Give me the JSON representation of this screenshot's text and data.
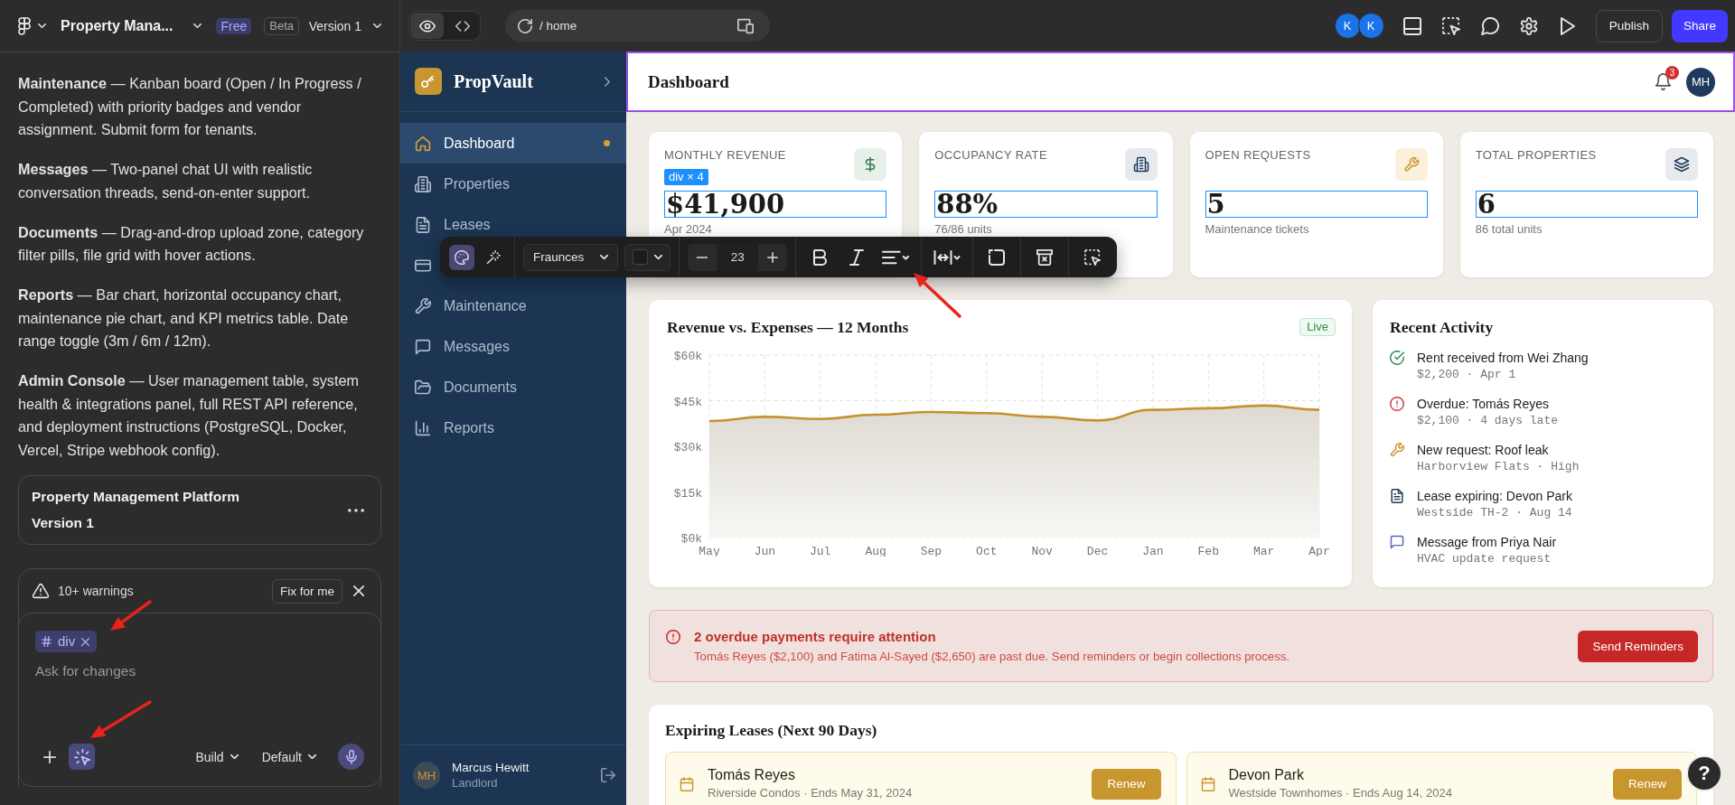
{
  "editor": {
    "project": "Property Mana...",
    "plan": "Free",
    "stage": "Beta",
    "version": "Version 1",
    "notes": [
      "**Maintenance** — Kanban board (Open / In Progress / Completed) with priority badges and vendor assignment. Submit form for tenants.",
      "**Messages** — Two-panel chat UI with realistic conversation threads, send-on-enter support.",
      "**Documents** — Drag-and-drop upload zone, category filter pills, file grid with hover actions.",
      "**Reports** — Bar chart, horizontal occupancy chart, maintenance pie chart, and KPI metrics table. Date range toggle (3m / 6m / 12m).",
      "**Admin Console** — User management table, system health & integrations panel, full REST API reference, and deployment instructions (PostgreSQL, Docker, Vercel, Stripe webhook config)."
    ],
    "project_card": {
      "title": "Property Management Platform",
      "subtitle": "Version 1"
    },
    "warnings": {
      "label": "10+ warnings",
      "action": "Fix for me"
    },
    "composer": {
      "chip": "div",
      "placeholder": "Ask for changes",
      "select_tool_on": true,
      "mode": "Build",
      "model": "Default"
    }
  },
  "topbar": {
    "views": [
      {
        "kind": "eye",
        "selected": true
      },
      {
        "kind": "code",
        "selected": false
      }
    ],
    "path": "/ home",
    "collaborators": [
      "K",
      "K"
    ],
    "publish": "Publish",
    "share": "Share"
  },
  "app": {
    "brand": "PropVault",
    "nav": [
      {
        "label": "Dashboard",
        "kind": "home",
        "selected": true,
        "dot": true
      },
      {
        "label": "Properties",
        "kind": "building",
        "selected": false,
        "dot": false
      },
      {
        "label": "Leases",
        "kind": "document",
        "selected": false,
        "dot": false
      },
      {
        "kind": "card",
        "selected": false,
        "dot": false
      },
      {
        "label": "Maintenance",
        "kind": "wrench",
        "selected": false,
        "dot": false
      },
      {
        "label": "Messages",
        "kind": "chat",
        "selected": false,
        "dot": false
      },
      {
        "label": "Documents",
        "kind": "folder",
        "selected": false,
        "dot": false
      },
      {
        "label": "Reports",
        "kind": "chart",
        "selected": false,
        "dot": false
      }
    ],
    "user": {
      "initials": "MH",
      "name": "Marcus Hewitt",
      "role": "Landlord"
    },
    "header": {
      "title": "Dashboard",
      "notifications": "3",
      "initials": "MH"
    },
    "kpis": [
      {
        "label": "MONTHLY REVENUE",
        "value": "$41,900",
        "sub": "Apr 2024",
        "kind": "dollar",
        "selected": true,
        "tag": "div × 4"
      },
      {
        "label": "OCCUPANCY RATE",
        "value": "88%",
        "sub": "76/86 units",
        "kind": "building",
        "selected": true
      },
      {
        "label": "OPEN REQUESTS",
        "value": "5",
        "sub": "Maintenance tickets",
        "kind": "wrench",
        "selected": true
      },
      {
        "label": "TOTAL PROPERTIES",
        "value": "6",
        "sub": "86 total units",
        "kind": "layers",
        "selected": true
      }
    ],
    "format_toolbar": {
      "modes": [
        {
          "kind": "palette",
          "selected": true
        },
        {
          "kind": "wand",
          "selected": false
        }
      ],
      "font": "Fraunces",
      "color": "#1c1c1c",
      "size": "23"
    },
    "revenue": {
      "title": "Revenue vs. Expenses — 12 Months",
      "status": "Live",
      "chart_data": {
        "type": "area",
        "grid": true,
        "categories": [
          "May",
          "Jun",
          "Jul",
          "Aug",
          "Sep",
          "Oct",
          "Nov",
          "Dec",
          "Jan",
          "Feb",
          "Mar",
          "Apr"
        ],
        "series": [
          {
            "color": "#c4922e",
            "values": [
              38300,
              39700,
              39000,
              40400,
              41300,
              40900,
              39700,
              38500,
              42000,
              42500,
              43400,
              42000
            ]
          }
        ],
        "ylim": [
          0,
          60000
        ],
        "yticks": [
          {
            "value": 0,
            "label": "$0k"
          },
          {
            "value": 15000,
            "label": "$15k"
          },
          {
            "value": 30000,
            "label": "$30k"
          },
          {
            "value": 45000,
            "label": "$45k"
          },
          {
            "value": 60000,
            "label": "$60k"
          }
        ]
      }
    },
    "activity": {
      "title": "Recent Activity",
      "items": [
        {
          "kind": "check",
          "title": "Rent received from Wei Zhang",
          "detail": "$2,200 · Apr 1"
        },
        {
          "kind": "alert",
          "title": "Overdue: Tomás Reyes",
          "detail": "$2,100 · 4 days late"
        },
        {
          "kind": "wrench",
          "title": "New request: Roof leak",
          "detail": "Harborview Flats · High"
        },
        {
          "kind": "document",
          "title": "Lease expiring: Devon Park",
          "detail": "Westside TH-2 · Aug 14"
        },
        {
          "kind": "chat",
          "title": "Message from Priya Nair",
          "detail": "HVAC update request"
        }
      ]
    },
    "alert": {
      "title": "2 overdue payments require attention",
      "text": "Tomás Reyes ($2,100) and Fatima Al-Sayed ($2,650) are past due. Send reminders or begin collections process.",
      "action": "Send Reminders"
    },
    "leases": {
      "title": "Expiring Leases (Next 90 Days)",
      "items": [
        {
          "name": "Tomás Reyes",
          "detail": "Riverside Condos · Ends May 31, 2024",
          "action": "Renew"
        },
        {
          "name": "Devon Park",
          "detail": "Westside Townhomes · Ends Aug 14, 2024",
          "action": "Renew"
        }
      ]
    },
    "help": "?"
  }
}
